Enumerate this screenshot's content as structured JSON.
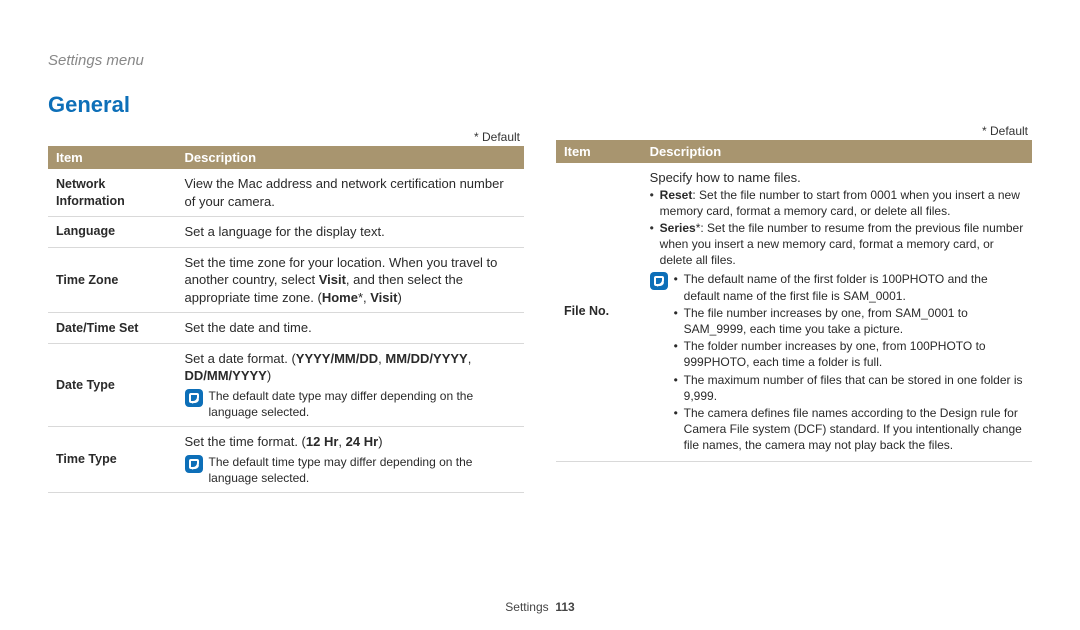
{
  "breadcrumb": "Settings menu",
  "section_title": "General",
  "default_marker": "* Default",
  "header_item": "Item",
  "header_desc": "Description",
  "left": {
    "network_info": {
      "label": "Network Information",
      "desc": "View the Mac address and network certification number of your camera."
    },
    "language": {
      "label": "Language",
      "desc": "Set a language for the display text."
    },
    "time_zone": {
      "label": "Time Zone",
      "desc_pre": "Set the time zone for your location. When you travel to another country, select ",
      "visit": "Visit",
      "desc_mid": ", and then select the appropriate time zone. (",
      "home": "Home",
      "star": "*, ",
      "visit2": "Visit",
      "desc_end": ")"
    },
    "datetime": {
      "label": "Date/Time Set",
      "desc": "Set the date and time."
    },
    "date_type": {
      "label": "Date Type",
      "desc_pre": "Set a date format. (",
      "opt1": "YYYY/MM/DD",
      "sep1": ", ",
      "opt2": "MM/DD/YYYY",
      "sep2": ", ",
      "opt3": "DD/MM/YYYY",
      "desc_end": ")",
      "note": "The default date type may differ depending on the language selected."
    },
    "time_type": {
      "label": "Time Type",
      "desc_pre": "Set the time format. (",
      "opt1": "12 Hr",
      "sep": ", ",
      "opt2": "24 Hr",
      "desc_end": ")",
      "note": "The default time type may differ depending on the language selected."
    }
  },
  "right": {
    "file_no": {
      "label": "File No.",
      "intro": "Specify how to name files.",
      "reset_label": "Reset",
      "reset_desc": ": Set the file number to start from 0001 when you insert a new memory card, format a memory card, or delete all files.",
      "series_label": "Series",
      "series_star": "*",
      "series_desc": ": Set the file number to resume from the previous file number when you insert a new memory card, format a memory card, or delete all files.",
      "notes": [
        "The default name of the first folder is 100PHOTO and the default name of the first file is SAM_0001.",
        "The file number increases by one, from SAM_0001 to SAM_9999, each time you take a picture.",
        "The folder number increases by one, from 100PHOTO to 999PHOTO, each time a folder is full.",
        "The maximum number of files that can be stored in one folder is 9,999.",
        "The camera defines file names according to the Design rule for Camera File system (DCF) standard. If you intentionally change file names, the camera may not play back the files."
      ]
    }
  },
  "footer": {
    "label": "Settings",
    "page": "113"
  }
}
